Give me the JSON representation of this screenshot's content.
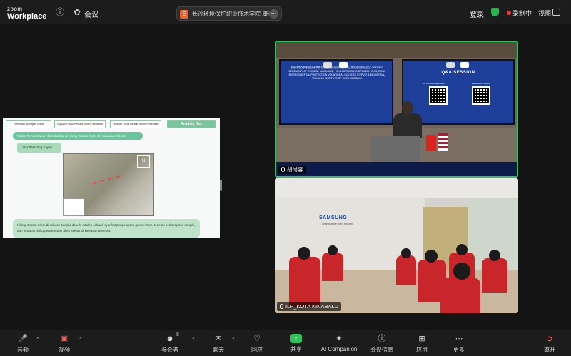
{
  "app": {
    "logo_line1": "zoom",
    "logo_line2": "Workplace"
  },
  "topbar": {
    "meeting_label": "会议",
    "meeting_title": "长沙环境保护职业技术学院 康诉",
    "login_label": "登录",
    "recording_label": "录制中",
    "view_label": "视图"
  },
  "share_content": {
    "tabs": [
      "Pemetaan Isu Kajian Untuk Pembelajaran",
      "Tinjauan Fokus Perkara Tanah Perdataran",
      "Tinjauan Fokus Bentuk Tanah Pembinaan",
      "Analisis Kes"
    ],
    "heading": "Kajian Pencemaran Alam Sekitar di Kilang Garam Krom di Kawasan Industri",
    "subheading": "Latar Belakang Kajian",
    "paragraph": "Kilang Garam Krom di sebuah bandar dahulu adalah sebuah syarikat pengeluaran garam krom, terletak berhampiran sungai, dan terdapat risiko pencemaran alam sekitar di kawasan tersebut."
  },
  "video_tiles": [
    {
      "name": "胡尚容",
      "slide_left_text": "长沙环境保护职业技术学院与 亚庇工业培训学院 中文+技能培训开班仪式 OPENING CEREMONY OF CHINESE LANGUAGE + SKILLS TRAINING BETWEEN CHANGSHA ENVIRONMENTAL PROTECTION VOCATIONAL COLLEGE (CEPVC) & INDUSTRIAL TRAINING INSTITUTE OF KOTA KINABALU",
      "slide_right_title": "Q&A SESSION",
      "qr_left_label": "ATTENDANCE FORM",
      "qr_right_label": "FEEDBACK FORM"
    },
    {
      "name": "ILP_KOTA KINABALU",
      "wall_brand": "SAMSUNG",
      "wall_sub": "Changing the world through"
    }
  ],
  "toolbar": {
    "audio": "音频",
    "video": "视频",
    "participants": "参会者",
    "participants_count": "8",
    "chat": "聊天",
    "react": "回应",
    "share": "共享",
    "ai_companion": "AI Companion",
    "meeting_info": "会议信息",
    "apps": "应用",
    "more": "更多",
    "leave": "离开"
  }
}
